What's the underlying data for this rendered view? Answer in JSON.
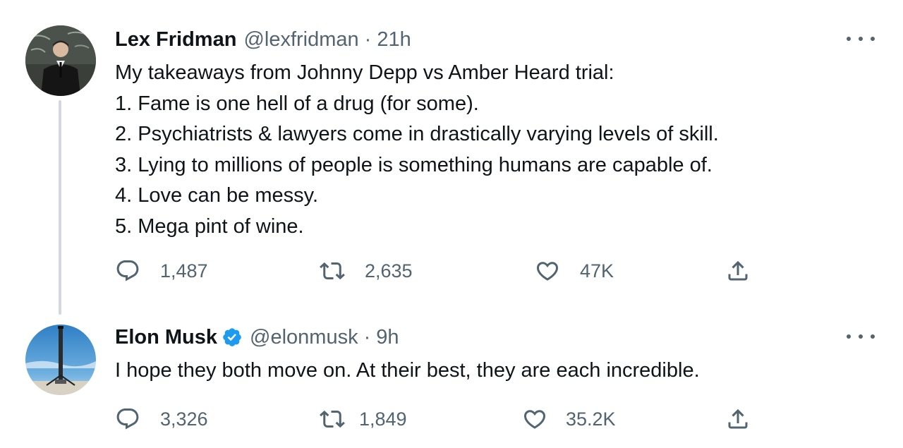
{
  "tweets": [
    {
      "display_name": "Lex Fridman",
      "handle": "@lexfridman",
      "separator": "·",
      "time": "21h",
      "verified": false,
      "lines": [
        "My takeaways from Johnny Depp vs Amber Heard trial:",
        "1. Fame is one hell of a drug (for some).",
        "2. Psychiatrists & lawyers come in drastically varying levels of skill.",
        "3. Lying to millions of people is something humans are capable of.",
        "4. Love can be messy.",
        "5. Mega pint of wine."
      ],
      "replies": "1,487",
      "retweets": "2,635",
      "likes": "47K"
    },
    {
      "display_name": "Elon Musk",
      "handle": "@elonmusk",
      "separator": "·",
      "time": "9h",
      "verified": true,
      "lines": [
        "I hope they both move on. At their best, they are each incredible."
      ],
      "replies": "3,326",
      "retweets": "1,849",
      "likes": "35.2K"
    }
  ],
  "icons": {
    "reply": "reply-icon",
    "retweet": "retweet-icon",
    "like": "heart-icon",
    "share": "share-icon",
    "more": "more-icon",
    "verified": "verified-badge-icon"
  },
  "colors": {
    "text": "#0f1419",
    "secondary": "#536471",
    "verified": "#1d9bf0",
    "thread_line": "#cfd9de"
  }
}
